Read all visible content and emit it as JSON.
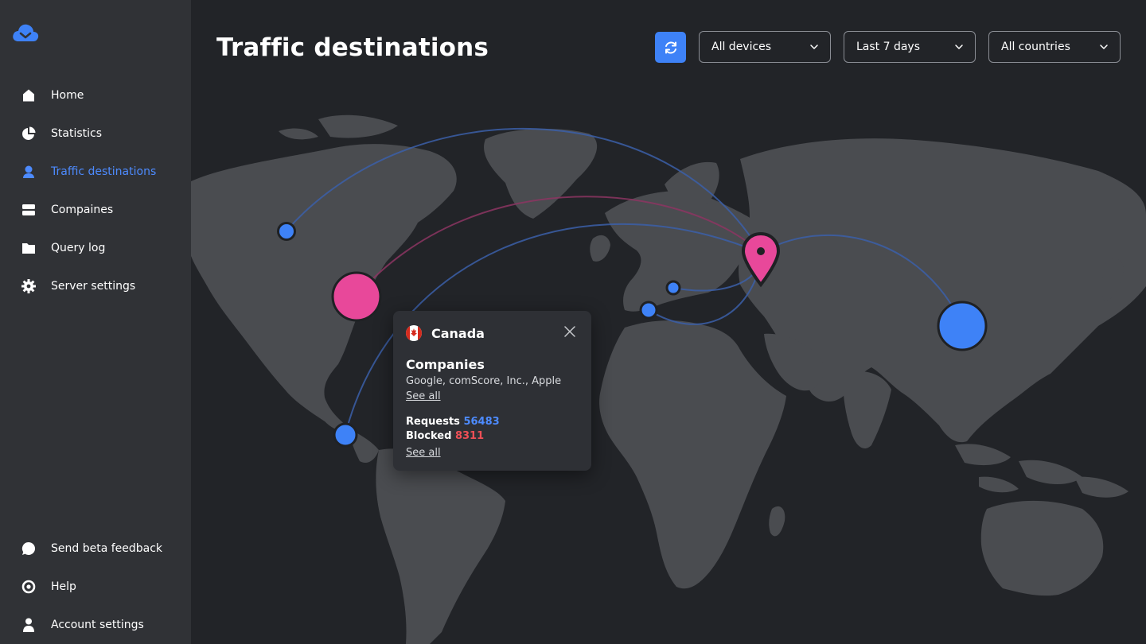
{
  "sidebar": {
    "logo_icon": "cloud-check-icon",
    "items": [
      {
        "label": "Home",
        "icon": "home-icon"
      },
      {
        "label": "Statistics",
        "icon": "pie-chart-icon"
      },
      {
        "label": "Traffic destinations",
        "icon": "user-pin-icon",
        "active": true
      },
      {
        "label": "Compaines",
        "icon": "server-icon"
      },
      {
        "label": "Query log",
        "icon": "folder-icon"
      },
      {
        "label": "Server settings",
        "icon": "gear-icon"
      }
    ],
    "bottom_items": [
      {
        "label": "Send beta feedback",
        "icon": "chat-bubble-icon"
      },
      {
        "label": "Help",
        "icon": "help-ring-icon"
      },
      {
        "label": "Account settings",
        "icon": "person-icon"
      }
    ]
  },
  "header": {
    "title": "Traffic destinations",
    "refresh_icon": "refresh-icon",
    "filters": {
      "devices": "All devices",
      "period": "Last 7 days",
      "countries": "All countries"
    }
  },
  "popup": {
    "country": "Canada",
    "flag_icon": "canada-flag-icon",
    "companies_title": "Companies",
    "companies": "Google, comScore, Inc., Apple",
    "see_all_companies": "See all",
    "requests_label": "Requests",
    "requests_value": "56483",
    "blocked_label": "Blocked",
    "blocked_value": "8311",
    "see_all_stats": "See all"
  },
  "colors": {
    "accent": "#3e82f7",
    "pink": "#e8489a",
    "blocked": "#ef4f56",
    "sidebar_bg": "#303236",
    "main_bg": "#222428",
    "land": "#4a4c50"
  }
}
